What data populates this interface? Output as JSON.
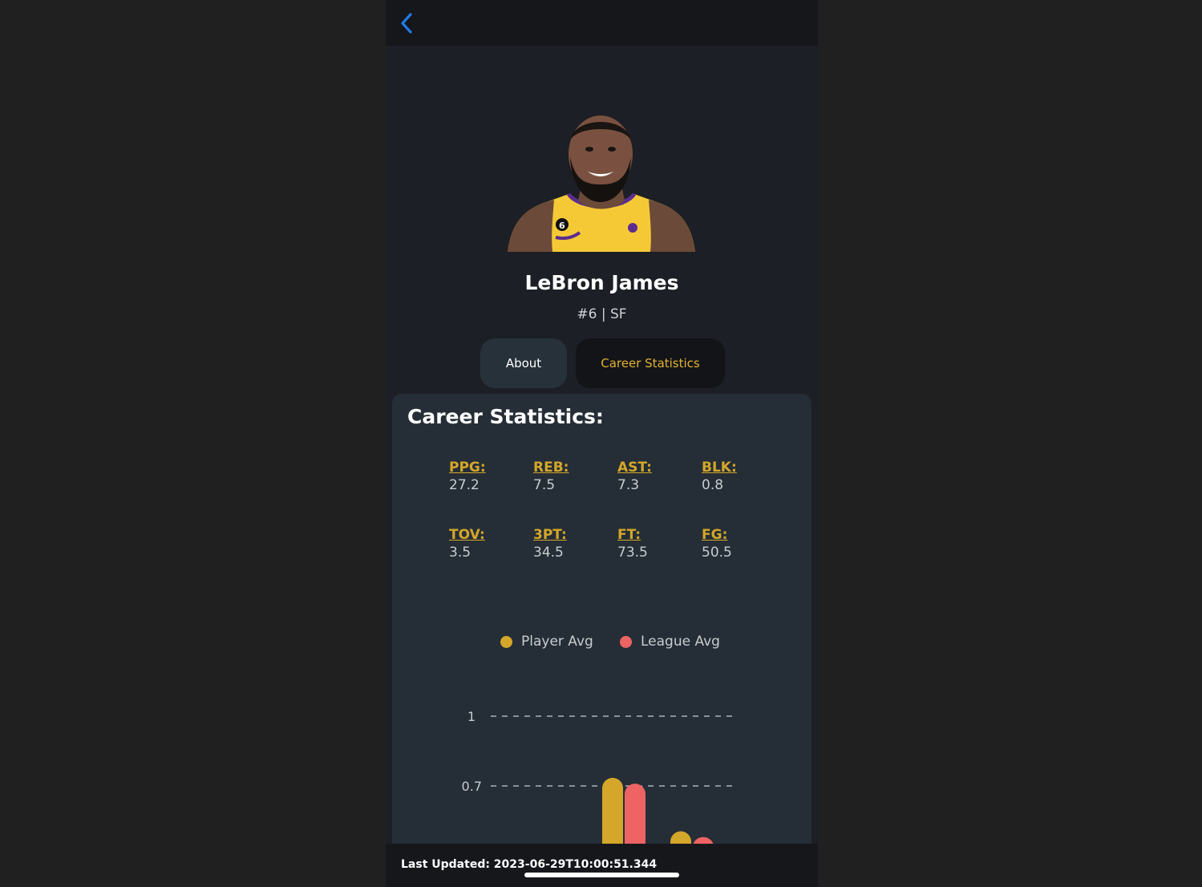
{
  "header": {
    "back_icon": "chevron-left-icon"
  },
  "player": {
    "name": "LeBron James",
    "subtitle": "#6 | SF",
    "avatar_icon": "player-portrait"
  },
  "tabs": [
    {
      "label": "About",
      "active": false
    },
    {
      "label": "Career Statistics",
      "active": true
    }
  ],
  "card": {
    "title": "Career Statistics:",
    "stats": [
      {
        "label": "PPG:",
        "value": "27.2"
      },
      {
        "label": "REB:",
        "value": "7.5"
      },
      {
        "label": "AST:",
        "value": "7.3"
      },
      {
        "label": "BLK:",
        "value": "0.8"
      },
      {
        "label": "TOV:",
        "value": "3.5"
      },
      {
        "label": "3PT:",
        "value": "34.5"
      },
      {
        "label": "FT:",
        "value": "73.5"
      },
      {
        "label": "FG:",
        "value": "50.5"
      }
    ]
  },
  "chart_data": {
    "type": "bar",
    "legend": [
      {
        "name": "Player Avg",
        "color": "#d4a72a"
      },
      {
        "name": "League Avg",
        "color": "#ee6363"
      }
    ],
    "y_ticks": [
      "1",
      "0.7"
    ],
    "series": [
      {
        "name": "Player Avg",
        "color": "#d4a72a",
        "values": [
          0.735,
          0.505
        ]
      },
      {
        "name": "League Avg",
        "color": "#ee6363",
        "values": [
          0.71,
          0.48
        ]
      }
    ],
    "grid": "dashed"
  },
  "footer": {
    "last_updated": "Last Updated: 2023-06-29T10:00:51.344"
  }
}
